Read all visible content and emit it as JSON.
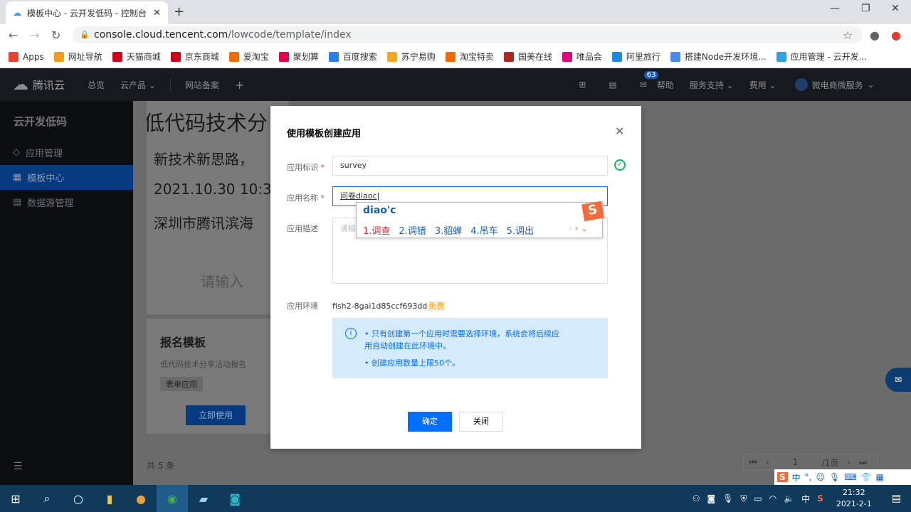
{
  "browser": {
    "tab_title": "模板中心 - 云开发低码 - 控制台",
    "url_host": "console.cloud.tencent.com",
    "url_path": "/lowcode/template/index",
    "bookmarks": [
      {
        "label": "Apps",
        "color": "#e94235"
      },
      {
        "label": "网址导航",
        "color": "#f59b1b"
      },
      {
        "label": "天猫商城",
        "color": "#d0021b"
      },
      {
        "label": "京东商城",
        "color": "#d0021b"
      },
      {
        "label": "爱淘宝",
        "color": "#f56a00"
      },
      {
        "label": "聚划算",
        "color": "#e6004c"
      },
      {
        "label": "百度搜索",
        "color": "#2a7ef4"
      },
      {
        "label": "苏宁易购",
        "color": "#f5a623"
      },
      {
        "label": "淘宝特卖",
        "color": "#f56a00"
      },
      {
        "label": "国美在线",
        "color": "#b3261e"
      },
      {
        "label": "唯品会",
        "color": "#e4007f"
      },
      {
        "label": "阿里旅行",
        "color": "#1f8ae6"
      },
      {
        "label": "搭建Node开发环境...",
        "color": "#4a8af4"
      },
      {
        "label": "应用管理 - 云开发...",
        "color": "#2fa3e6"
      }
    ]
  },
  "topnav": {
    "logo": "腾讯云",
    "items": [
      "总览",
      "云产品",
      "网站备案"
    ],
    "mail_badge": "63",
    "help": "帮助",
    "service": "服务支持",
    "fee": "费用",
    "account": "微电商微服务"
  },
  "sidebar": {
    "title": "云开发低码",
    "items": [
      {
        "label": "应用管理",
        "icon": "layers-icon"
      },
      {
        "label": "模板中心",
        "icon": "grid-icon",
        "active": true
      },
      {
        "label": "数据源管理",
        "icon": "doc-icon"
      }
    ]
  },
  "card": {
    "banner_lines": [
      "低代码技术分",
      "新技术新思路，",
      "2021.10.30 10:3",
      "深圳市腾讯滨海"
    ],
    "placeholder": "请输入",
    "title": "报名模板",
    "desc": "低代码技术分享活动报名",
    "tag": "表单应用",
    "use_btn": "立即使用"
  },
  "footer": {
    "total": "共 5 条",
    "page": "1",
    "pages": "/1页"
  },
  "modal": {
    "title": "使用模板创建应用",
    "id_label": "应用标识",
    "id_value": "survey",
    "name_label": "应用名称",
    "name_value": "问卷diaoc",
    "desc_label": "应用描述",
    "desc_placeholder": "请输入",
    "env_label": "应用环境",
    "env_value": "fish2-8gai1d85ccf693dd",
    "env_badge": "免费",
    "notes": [
      "只有创建第一个应用时需要选择环境，系统会将后续应用自动创建在此环境中。",
      "创建应用数量上限50个。"
    ],
    "ok": "确定",
    "close": "关闭"
  },
  "ime": {
    "composition": "diao'c",
    "candidates": [
      "1.调查",
      "2.调错",
      "3.貂蝉",
      "4.吊车",
      "5.调出"
    ],
    "toolbar": "中"
  },
  "taskbar": {
    "time": "21:32",
    "date": "2021-2-1",
    "lang": "中"
  }
}
